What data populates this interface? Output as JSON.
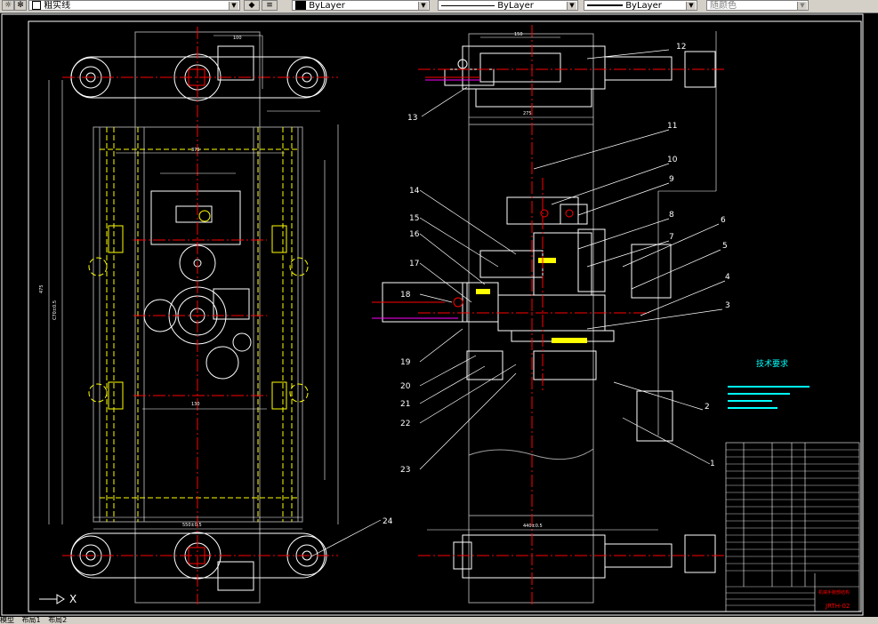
{
  "toolbar": {
    "layer_name": "粗实线",
    "color_value": "ByLayer",
    "linetype_value": "ByLayer",
    "lineweight_value": "ByLayer",
    "plotstyle_value": "随颜色",
    "layer_icon": "layer-manager-icon",
    "layer_state_icon": "layer-states-icon"
  },
  "drawing": {
    "part_numbers": [
      "1",
      "2",
      "3",
      "4",
      "5",
      "6",
      "7",
      "8",
      "9",
      "10",
      "11",
      "12",
      "13",
      "14",
      "15",
      "16",
      "17",
      "18",
      "19",
      "20",
      "21",
      "22",
      "23",
      "24"
    ],
    "tech_title": "技术要求",
    "drawing_number": "JRTH-02",
    "title_block_name": "机械手腕部结构"
  },
  "ucs": {
    "axis_label": "X"
  },
  "layout_tabs": [
    "模型",
    "布局1",
    "布局2"
  ]
}
